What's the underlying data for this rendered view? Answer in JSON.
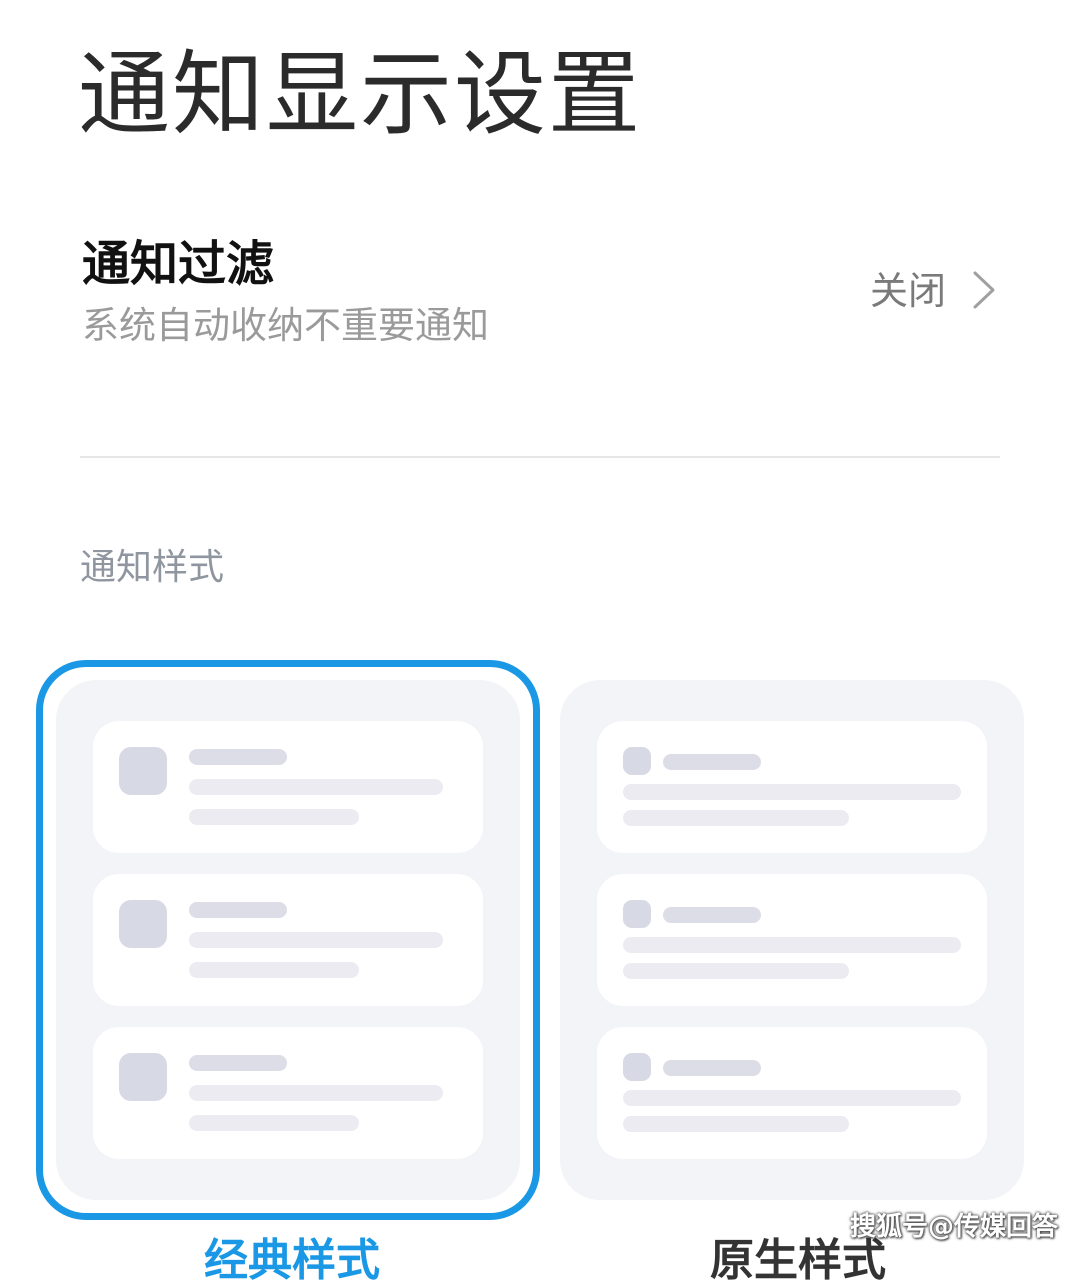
{
  "page": {
    "title": "通知显示设置"
  },
  "filter": {
    "title": "通知过滤",
    "subtitle": "系统自动收纳不重要通知",
    "value": "关闭",
    "chevron_icon": "chevron-right-icon"
  },
  "notification_style": {
    "section_label": "通知样式",
    "options": [
      {
        "label": "经典样式",
        "selected": true
      },
      {
        "label": "原生样式",
        "selected": false
      }
    ]
  },
  "colors": {
    "accent": "#1a98e6",
    "card_background": "#f3f4f8"
  },
  "watermark": "搜狐号@传媒回答"
}
